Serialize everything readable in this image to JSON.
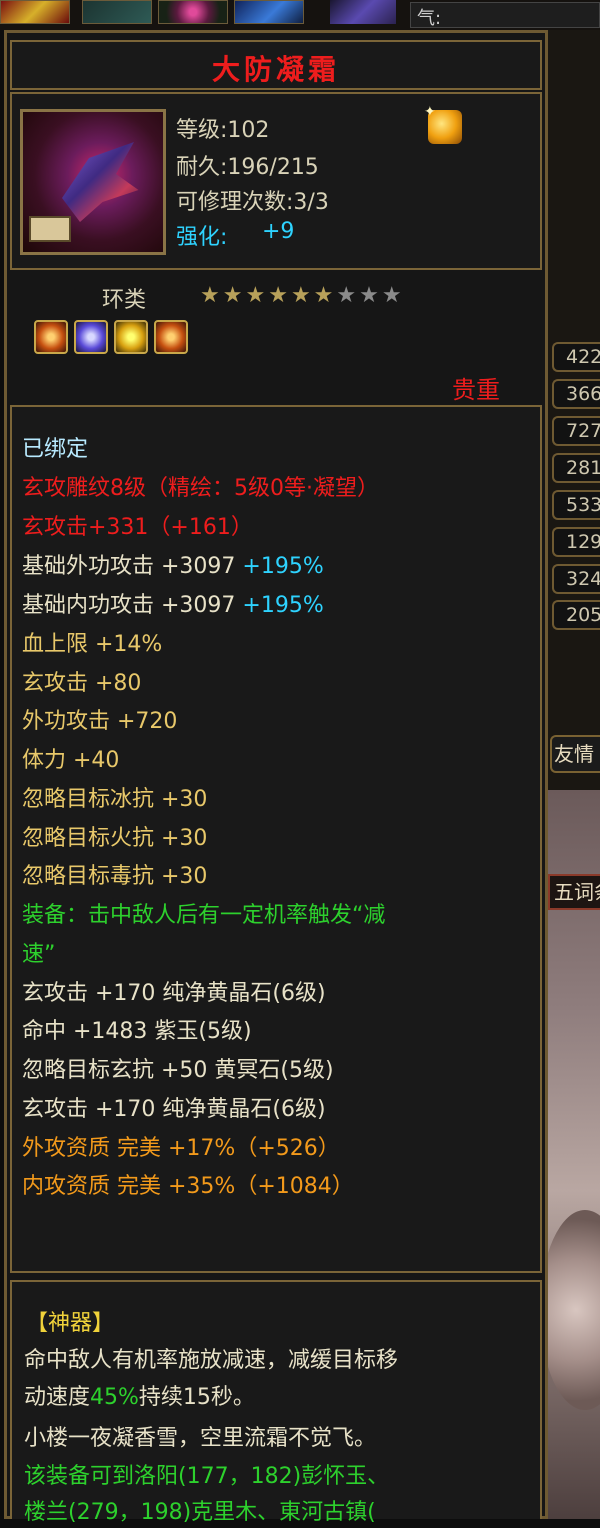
{
  "top_bar": {
    "qi_label": "气:"
  },
  "item": {
    "name": "大防凝霜",
    "level": "等级:102",
    "durability": "耐久:196/215",
    "repairs": "可修理次数:3/3",
    "enhance_label": "强化:",
    "enhance_value": "+9",
    "type": "环类",
    "stars_on": 6,
    "stars_total": 9,
    "rarity": "贵重",
    "gem_icons": [
      "orange-gem-icon",
      "violet-gem-icon",
      "yellow-gem-icon",
      "orange-gem-icon"
    ]
  },
  "attributes": {
    "bound": "已绑定",
    "engrave": "玄攻雕纹8级（精绘：5级0等·凝望）",
    "xuan_main": "玄攻击+331（+161）",
    "ext_base": "基础外功攻击 +3097",
    "ext_base_pct": "+195%",
    "int_base": "基础内功攻击 +3097",
    "int_base_pct": "+195%",
    "stats": [
      "血上限 +14%",
      "玄攻击 +80",
      "外功攻击 +720",
      "体力 +40",
      "忽略目标冰抗 +30",
      "忽略目标火抗 +30",
      "忽略目标毒抗 +30"
    ],
    "equip_effect_1": "装备：击中敌人后有一定机率触发“减",
    "equip_effect_2": "速”",
    "gem_stats": [
      "玄攻击 +170 纯净黄晶石(6级)",
      "命中 +1483 紫玉(5级)",
      "忽略目标玄抗 +50 黄冥石(5级)",
      "玄攻击 +170 纯净黄晶石(6级)"
    ],
    "aptitudes": [
      "外攻资质  完美 +17%（+526）",
      "内攻资质  完美 +35%（+1084）"
    ]
  },
  "artifact": {
    "title": "【神器】",
    "desc_1": "命中敌人有机率施放减速，减缓目标移",
    "desc_2a": "动速度",
    "desc_2b": "45%",
    "desc_2c": "持续15秒。",
    "poem": "小楼一夜凝香雪，空里流霜不觉飞。",
    "source_1": "该装备可到洛阳(177，182)彭怀玉、",
    "source_2": "楼兰(279，198)克里木、東河古镇("
  },
  "right_panel": {
    "values": [
      "422",
      "366",
      "727",
      "281",
      "533",
      "129",
      "324",
      "205"
    ],
    "button_1": "友情",
    "button_2": "五词条"
  }
}
